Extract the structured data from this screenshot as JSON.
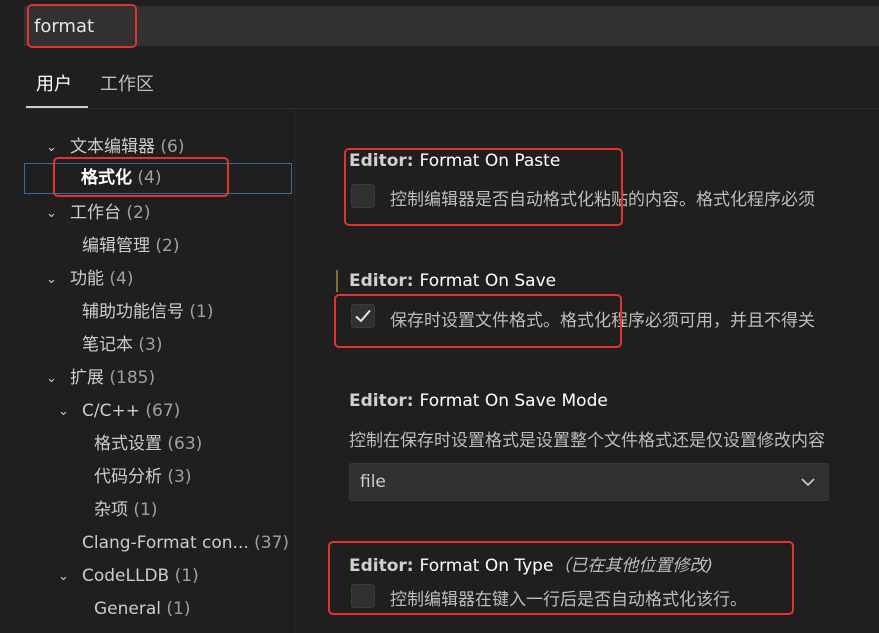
{
  "search": {
    "value": "format"
  },
  "tabs": [
    {
      "label": "用户",
      "active": true
    },
    {
      "label": "工作区",
      "active": false
    }
  ],
  "tree": [
    {
      "label": "文本编辑器",
      "count": "(6)",
      "expanded": true
    },
    {
      "label": "格式化",
      "count": "(4)",
      "selected": true
    },
    {
      "label": "工作台",
      "count": "(2)",
      "expanded": true
    },
    {
      "label": "编辑管理",
      "count": "(2)"
    },
    {
      "label": "功能",
      "count": "(4)",
      "expanded": true
    },
    {
      "label": "辅助功能信号",
      "count": "(1)"
    },
    {
      "label": "笔记本",
      "count": "(3)"
    },
    {
      "label": "扩展",
      "count": "(185)",
      "expanded": true
    },
    {
      "label": "C/C++",
      "count": "(67)",
      "expanded": true
    },
    {
      "label": "格式设置",
      "count": "(63)"
    },
    {
      "label": "代码分析",
      "count": "(3)"
    },
    {
      "label": "杂项",
      "count": "(1)"
    },
    {
      "label": "Clang-Format con...",
      "count": "(37)"
    },
    {
      "label": "CodeLLDB",
      "count": "(1)",
      "expanded": true
    },
    {
      "label": "General",
      "count": "(1)"
    }
  ],
  "settings": [
    {
      "category": "Editor: ",
      "name": "Format On Paste",
      "description": "控制编辑器是否自动格式化粘贴的内容。格式化程序必须",
      "checked": false
    },
    {
      "category": "Editor: ",
      "name": "Format On Save",
      "description": "保存时设置文件格式。格式化程序必须可用，并且不得关",
      "checked": true
    },
    {
      "category": "Editor: ",
      "name": "Format On Save Mode",
      "description": "控制在保存时设置格式是设置整个文件格式还是仅设置修改内容",
      "value": "file"
    },
    {
      "category": "Editor: ",
      "name": "Format On Type",
      "note": "（已在其他位置修改)",
      "description": "控制编辑器在键入一行后是否自动格式化该行。",
      "checked": false
    }
  ],
  "colors": {
    "highlight": "#e0352b",
    "background": "#1f1f1f",
    "selection_border": "#2f6ea3"
  }
}
